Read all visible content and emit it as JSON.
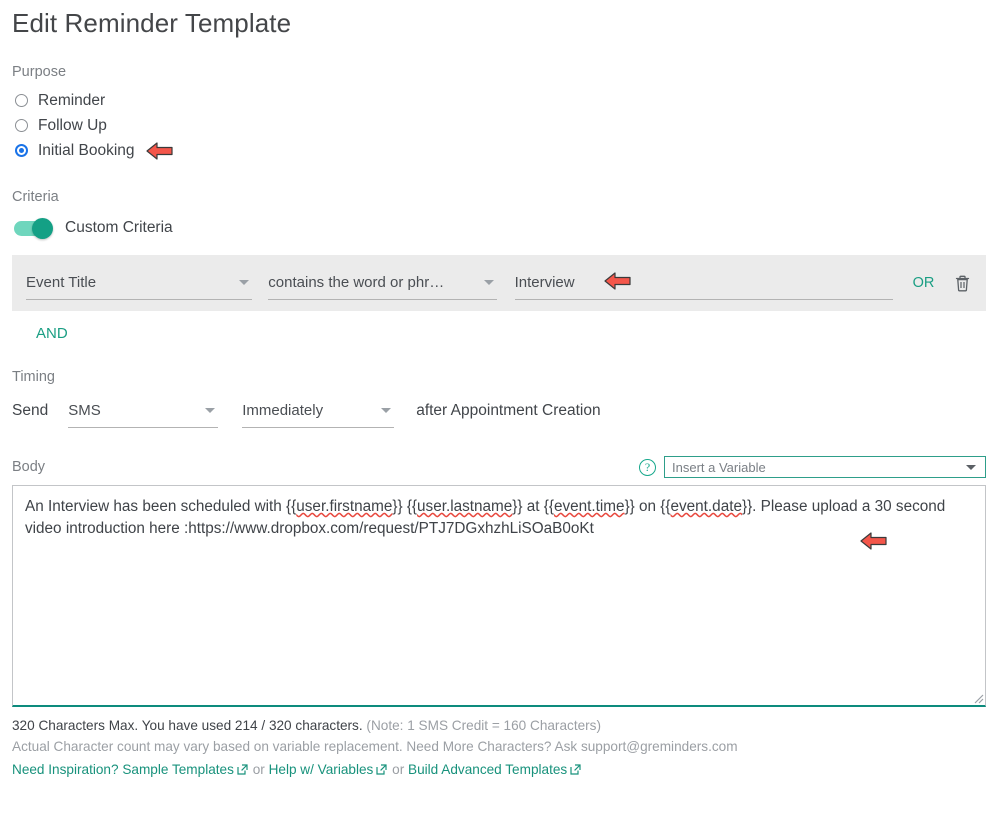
{
  "page": {
    "title": "Edit Reminder Template"
  },
  "purpose": {
    "label": "Purpose",
    "options": [
      {
        "label": "Reminder",
        "selected": false
      },
      {
        "label": "Follow Up",
        "selected": false
      },
      {
        "label": "Initial Booking",
        "selected": true
      }
    ]
  },
  "criteria": {
    "label": "Criteria",
    "toggle_label": "Custom Criteria",
    "toggle_on": true,
    "row": {
      "field": "Event Title",
      "operator": "contains the word or phr…",
      "value": "Interview",
      "value_placeholder": "",
      "or_label": "OR",
      "delete_icon": "trash-icon"
    },
    "and_label": "AND"
  },
  "timing": {
    "label": "Timing",
    "send_label": "Send",
    "channel": "SMS",
    "when": "Immediately",
    "suffix": "after Appointment Creation"
  },
  "body": {
    "label": "Body",
    "help_icon": "help-circle-icon",
    "variable_select_placeholder": "Insert a Variable",
    "text_parts": [
      {
        "t": "An Interview has been scheduled with {{",
        "err": false
      },
      {
        "t": "user.firstname",
        "err": true
      },
      {
        "t": "}} {{",
        "err": false
      },
      {
        "t": "user.lastname",
        "err": true
      },
      {
        "t": "}} at {{",
        "err": false
      },
      {
        "t": "event.time",
        "err": true
      },
      {
        "t": "}} on {{",
        "err": false
      },
      {
        "t": "event.date",
        "err": true
      },
      {
        "t": "}}. Please upload a 30 second video introduction here :https://www.dropbox.com/request/PTJ7DGxhzhLiSOaB0oKt",
        "err": false
      }
    ],
    "full_text": "An Interview has been scheduled with {{user.firstname}} {{user.lastname}} at {{event.time}} on {{event.date}}. Please upload a 30 second video introduction here :https://www.dropbox.com/request/PTJ7DGxhzhLiSOaB0oKt"
  },
  "footer": {
    "counter_main": "320 Characters Max. You have used 214 / 320 characters.",
    "counter_note": "(Note: 1 SMS Credit = 160 Characters)",
    "line2": "Actual Character count may vary based on variable replacement. Need More Characters? Ask support@greminders.com",
    "links_prefix": "Need Inspiration? Sample Templates",
    "or_1": "or",
    "link2": "Help w/ Variables",
    "or_2": "or",
    "link3": "Build Advanced Templates"
  },
  "annotations": {
    "arrow_icon": "left-arrow-annotation"
  },
  "colors": {
    "accent_teal": "#18927c",
    "toggle_on": "#14a085",
    "radio_selected": "#1a73e8",
    "annotation_red": "#f4564a",
    "panel_bg": "#ebebeb"
  }
}
